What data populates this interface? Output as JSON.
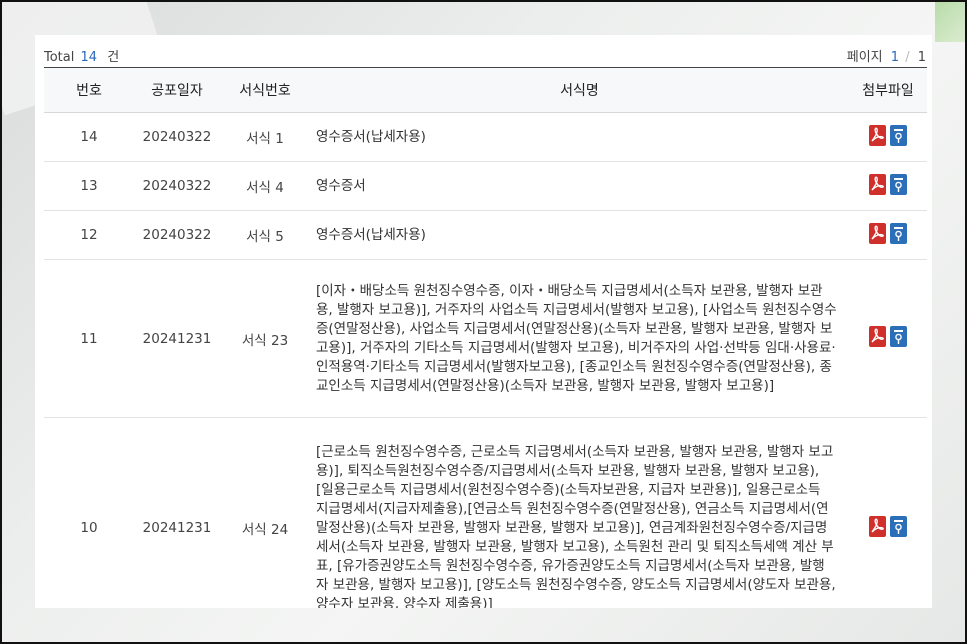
{
  "summary": {
    "total_label": "Total",
    "total_count": "14",
    "total_unit": "건"
  },
  "pager": {
    "label": "페이지",
    "current": "1",
    "separator": "/",
    "total": "1"
  },
  "table": {
    "headers": [
      "번호",
      "공포일자",
      "서식번호",
      "서식명",
      "첨부파일"
    ],
    "rows": [
      {
        "no": "14",
        "date": "20240322",
        "form": "서식 1",
        "title": "영수증서(납세자용)"
      },
      {
        "no": "13",
        "date": "20240322",
        "form": "서식 4",
        "title": "영수증서"
      },
      {
        "no": "12",
        "date": "20240322",
        "form": "서식 5",
        "title": "영수증서(납세자용)"
      },
      {
        "no": "11",
        "date": "20241231",
        "form": "서식 23",
        "title": "[이자・배당소득 원천징수영수증, 이자・배당소득 지급명세서(소득자 보관용, 발행자 보관용, 발행자 보고용)], 거주자의 사업소득 지급명세서(발행자 보고용), [사업소득 원천징수영수증(연말정산용), 사업소득 지급명세서(연말정산용)(소득자 보관용, 발행자 보관용, 발행자 보고용)], 거주자의 기타소득 지급명세서(발행자 보고용), 비거주자의 사업·선박등 임대·사용료·인적용역·기타소득 지급명세서(발행자보고용), [종교인소득 원천징수영수증(연말정산용), 종교인소득 지급명세서(연말정산용)(소득자 보관용, 발행자 보관용, 발행자 보고용)]"
      },
      {
        "no": "10",
        "date": "20241231",
        "form": "서식 24",
        "title": "[근로소득 원천징수영수증, 근로소득 지급명세서(소득자 보관용, 발행자 보관용, 발행자 보고용)], 퇴직소득원천징수영수증/지급명세서(소득자 보관용, 발행자 보관용, 발행자 보고용), [일용근로소득 지급명세서(원천징수영수증)(소득자보관용, 지급자 보관용)], 일용근로소득 지급명세서(지급자제출용),[연금소득 원천징수영수증(연말정산용), 연금소득 지급명세서(연말정산용)(소득자 보관용, 발행자 보관용, 발행자 보고용)], 연금계좌원천징수영수증/지급명세서(소득자 보관용, 발행자 보관용, 발행자 보고용), 소득원천 관리 및 퇴직소득세액 계산 부표, [유가증권양도소득 원천징수영수증, 유가증권양도소득 지급명세서(소득자 보관용, 발행자 보관용, 발행자 보고용)], [양도소득 원천징수영수증, 양도소득 지급명세서(양도자 보관용, 양수자 보관용, 양수자 제출용)]"
      }
    ]
  },
  "icons": {
    "pdf": "pdf-file-icon",
    "hwp": "hwp-file-icon"
  },
  "colors": {
    "accent": "#2a6ab8",
    "pdf": "#d0302b",
    "hwp": "#2b6fb8"
  }
}
